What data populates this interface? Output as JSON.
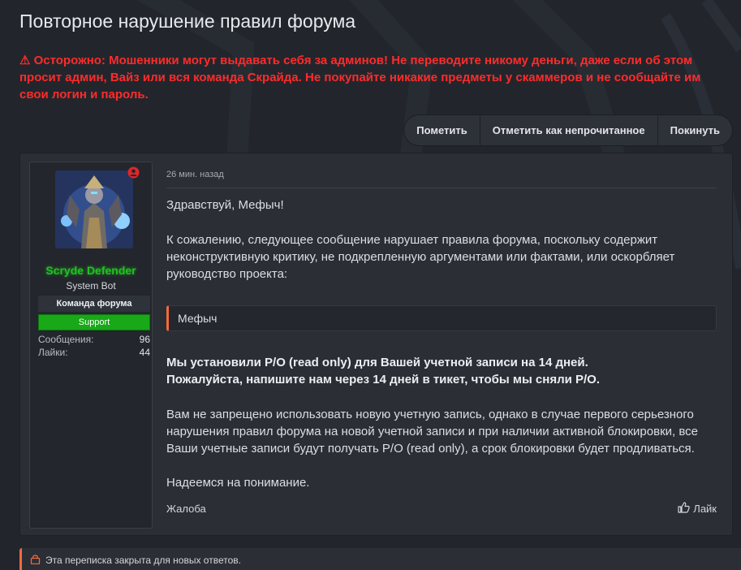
{
  "thread": {
    "title": "Повторное нарушение правил форума",
    "warning": "⚠ Осторожно: Мошенники могут выдавать себя за админов! Не переводите никому деньги, даже если об этом просит админ, Вайз или вся команда Скрайда. Не покупайте никакие предметы у скаммеров и не сообщайте им свои логин и пароль."
  },
  "actions": {
    "mark": "Пометить",
    "mark_unread": "Отметить как непрочитанное",
    "leave": "Покинуть"
  },
  "user": {
    "name": "Scryde Defender",
    "title": "System Bot",
    "team_banner": "Команда форума",
    "support_banner": "Support",
    "stats": [
      {
        "label": "Сообщения:",
        "value": "96"
      },
      {
        "label": "Лайки:",
        "value": "44"
      }
    ]
  },
  "post": {
    "time": "26 мин. назад",
    "greeting": "Здравствуй, Мефыч!",
    "paragraph1": "К сожалению, следующее сообщение нарушает правила форума, поскольку содержит неконструктивную критику, не подкрепленную аргументами или фактами, или оскорбляет руководство проекта:",
    "quote_author": "Мефыч",
    "bold_line1": "Мы установили Р/О (read only) для Вашей учетной записи на 14 дней.",
    "bold_line2": "Пожалуйста, напишите нам через 14 дней в тикет, чтобы мы сняли Р/О.",
    "paragraph2": "Вам не запрещено использовать новую учетную запись, однако в случае первого серьезного нарушения правил форума на новой учетной записи и при наличии активной блокировки, все Ваши учетные записи будут получать Р/О (read only), а срок блокировки будет продливаться.",
    "closing": "Надеемся на понимание.",
    "report": "Жалоба",
    "like": "Лайк"
  },
  "closed_notice": "Эта переписка закрыта для новых ответов.",
  "colors": {
    "warning": "#ff2b2b",
    "username": "#1ec41e",
    "support": "#18a818",
    "accent": "#f26b3a",
    "online": "#e0262a"
  },
  "icons": {
    "warning": "warning-icon",
    "online": "online-status-icon",
    "like": "thumbs-up-icon",
    "lock": "lock-icon"
  }
}
